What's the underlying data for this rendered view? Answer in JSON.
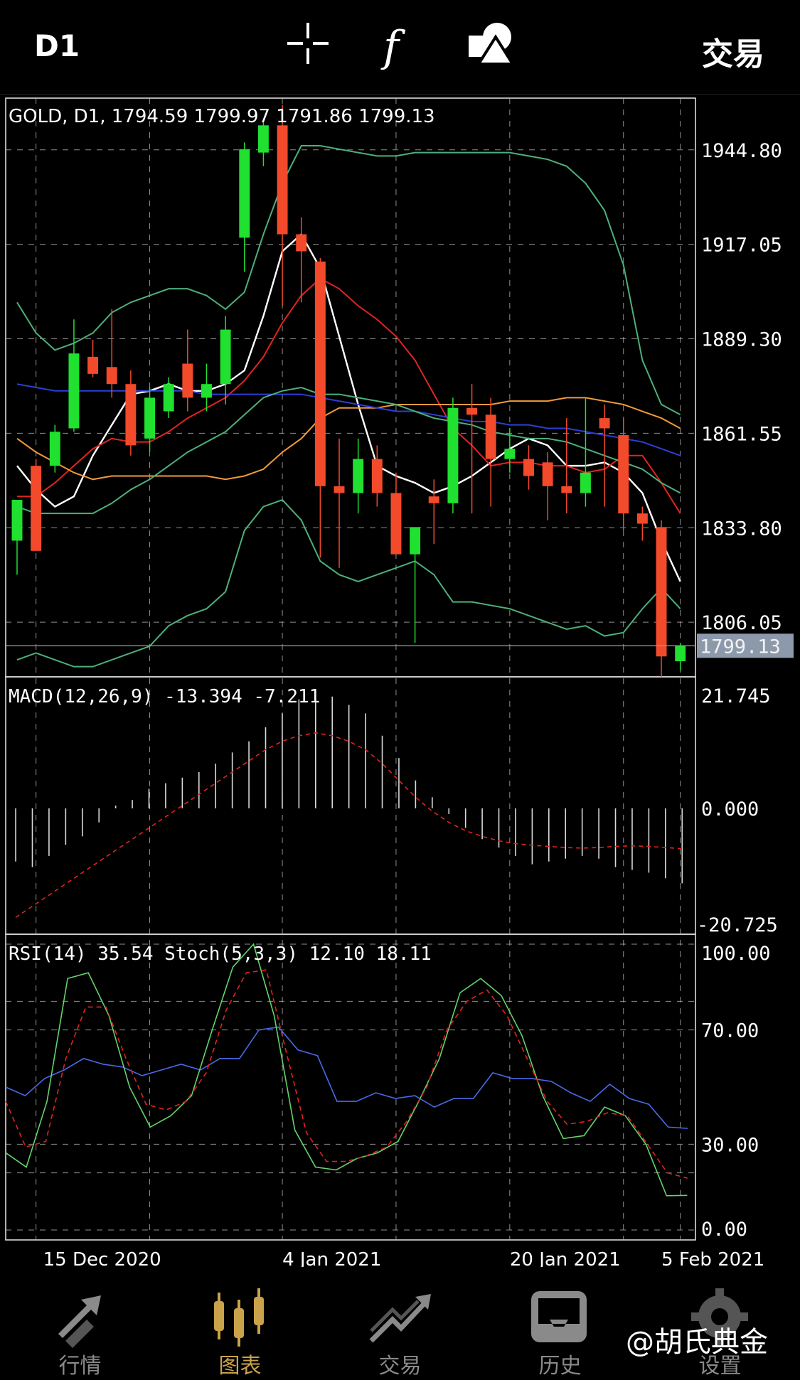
{
  "header": {
    "timeframe": "D1",
    "trade_label": "交易"
  },
  "chart_data": [
    {
      "type": "candlestick",
      "title": "GOLD, D1, 1794.59 1799.97 1791.86 1799.13",
      "x_labels": [
        "15 Dec 2020",
        "4 Jan 2021",
        "20 Jan 2021",
        "5 Feb 2021"
      ],
      "y_ticks": [
        "1944.80",
        "1917.05",
        "1889.30",
        "1861.55",
        "1833.80",
        "1806.05"
      ],
      "ylim": [
        1790,
        1960
      ],
      "last_price": "1799.13",
      "candles": [
        {
          "o": 1830,
          "h": 1836,
          "l": 1820,
          "c": 1842
        },
        {
          "o": 1852,
          "h": 1854,
          "l": 1830,
          "c": 1827
        },
        {
          "o": 1852,
          "h": 1864,
          "l": 1850,
          "c": 1862
        },
        {
          "o": 1863,
          "h": 1895,
          "l": 1862,
          "c": 1885
        },
        {
          "o": 1884,
          "h": 1889,
          "l": 1878,
          "c": 1879
        },
        {
          "o": 1881,
          "h": 1898,
          "l": 1872,
          "c": 1876
        },
        {
          "o": 1876,
          "h": 1880,
          "l": 1855,
          "c": 1858
        },
        {
          "o": 1860,
          "h": 1875,
          "l": 1856,
          "c": 1872
        },
        {
          "o": 1868,
          "h": 1878,
          "l": 1866,
          "c": 1876
        },
        {
          "o": 1882,
          "h": 1892,
          "l": 1868,
          "c": 1872
        },
        {
          "o": 1872,
          "h": 1882,
          "l": 1868,
          "c": 1876
        },
        {
          "o": 1876,
          "h": 1896,
          "l": 1870,
          "c": 1892
        },
        {
          "o": 1919,
          "h": 1947,
          "l": 1909,
          "c": 1945
        },
        {
          "o": 1944,
          "h": 1953,
          "l": 1940,
          "c": 1952
        },
        {
          "o": 1952,
          "h": 1958,
          "l": 1899,
          "c": 1920
        },
        {
          "o": 1920,
          "h": 1925,
          "l": 1900,
          "c": 1915
        },
        {
          "o": 1912,
          "h": 1913,
          "l": 1825,
          "c": 1846
        },
        {
          "o": 1846,
          "h": 1860,
          "l": 1822,
          "c": 1844
        },
        {
          "o": 1844,
          "h": 1860,
          "l": 1838,
          "c": 1854
        },
        {
          "o": 1854,
          "h": 1858,
          "l": 1840,
          "c": 1844
        },
        {
          "o": 1844,
          "h": 1850,
          "l": 1826,
          "c": 1826
        },
        {
          "o": 1826,
          "h": 1832,
          "l": 1800,
          "c": 1834
        },
        {
          "o": 1843,
          "h": 1848,
          "l": 1829,
          "c": 1841
        },
        {
          "o": 1841,
          "h": 1872,
          "l": 1838,
          "c": 1869
        },
        {
          "o": 1869,
          "h": 1876,
          "l": 1838,
          "c": 1867
        },
        {
          "o": 1867,
          "h": 1872,
          "l": 1840,
          "c": 1854
        },
        {
          "o": 1854,
          "h": 1863,
          "l": 1850,
          "c": 1857
        },
        {
          "o": 1854,
          "h": 1858,
          "l": 1845,
          "c": 1849
        },
        {
          "o": 1853,
          "h": 1856,
          "l": 1836,
          "c": 1846
        },
        {
          "o": 1846,
          "h": 1866,
          "l": 1838,
          "c": 1844
        },
        {
          "o": 1844,
          "h": 1872,
          "l": 1840,
          "c": 1850
        },
        {
          "o": 1866,
          "h": 1870,
          "l": 1840,
          "c": 1863
        },
        {
          "o": 1861,
          "h": 1866,
          "l": 1833,
          "c": 1838
        },
        {
          "o": 1838,
          "h": 1840,
          "l": 1830,
          "c": 1835
        },
        {
          "o": 1834,
          "h": 1836,
          "l": 1790,
          "c": 1796
        },
        {
          "o": 1794.59,
          "h": 1799.97,
          "l": 1791.86,
          "c": 1799.13
        }
      ],
      "overlays": [
        {
          "name": "ma-fast",
          "color": "#ffffff",
          "values": [
            1852,
            1845,
            1840,
            1843,
            1855,
            1864,
            1873,
            1874,
            1876,
            1874,
            1874,
            1876,
            1880,
            1896,
            1915,
            1920,
            1910,
            1890,
            1870,
            1852,
            1849,
            1847,
            1844,
            1846,
            1849,
            1853,
            1857,
            1860,
            1858,
            1852,
            1852,
            1853,
            1850,
            1844,
            1830,
            1818
          ]
        },
        {
          "name": "ma-mid",
          "color": "#e0241f",
          "values": [
            1843,
            1843,
            1847,
            1852,
            1857,
            1860,
            1859,
            1859,
            1862,
            1866,
            1869,
            1872,
            1877,
            1884,
            1894,
            1902,
            1907,
            1904,
            1899,
            1895,
            1890,
            1883,
            1873,
            1863,
            1858,
            1852,
            1853,
            1853,
            1852,
            1852,
            1850,
            1851,
            1855,
            1855,
            1847,
            1838
          ]
        },
        {
          "name": "ma-slow",
          "color": "#f29a3a",
          "values": [
            1860,
            1856,
            1853,
            1850,
            1848,
            1849,
            1849,
            1849,
            1849,
            1849,
            1849,
            1848,
            1849,
            1851,
            1856,
            1860,
            1866,
            1869,
            1869,
            1869,
            1870,
            1870,
            1870,
            1870,
            1870,
            1870,
            1871,
            1871,
            1871,
            1872,
            1872,
            1871,
            1870,
            1868,
            1866,
            1863
          ]
        },
        {
          "name": "ma-long",
          "color": "#2b3fd6",
          "values": [
            1876,
            1875,
            1874,
            1874,
            1874,
            1874,
            1874,
            1874,
            1874,
            1874,
            1873,
            1873,
            1873,
            1873,
            1873,
            1873,
            1872,
            1871,
            1870,
            1869,
            1868,
            1868,
            1867,
            1866,
            1865,
            1865,
            1864,
            1864,
            1863,
            1863,
            1862,
            1861,
            1860,
            1859,
            1857,
            1855
          ]
        },
        {
          "name": "bb-upper",
          "color": "#4db07a",
          "values": [
            1900,
            1891,
            1886,
            1888,
            1891,
            1897,
            1900,
            1902,
            1904,
            1904,
            1902,
            1898,
            1903,
            1920,
            1935,
            1946,
            1946,
            1945,
            1944,
            1943,
            1943,
            1944,
            1944,
            1944,
            1944,
            1944,
            1944,
            1943,
            1942,
            1940,
            1935,
            1927,
            1911,
            1883,
            1870,
            1867
          ]
        },
        {
          "name": "bb-mid",
          "color": "#4db07a",
          "values": [
            1840,
            1838,
            1838,
            1838,
            1838,
            1841,
            1845,
            1848,
            1852,
            1856,
            1859,
            1862,
            1867,
            1872,
            1874,
            1875,
            1873,
            1873,
            1872,
            1871,
            1870,
            1868,
            1866,
            1865,
            1864,
            1862,
            1861,
            1860,
            1860,
            1859,
            1857,
            1855,
            1853,
            1851,
            1847,
            1844
          ]
        },
        {
          "name": "bb-lower",
          "color": "#4db07a",
          "values": [
            1795,
            1797,
            1795,
            1793,
            1793,
            1795,
            1797,
            1799,
            1805,
            1808,
            1810,
            1815,
            1833,
            1840,
            1842,
            1836,
            1824,
            1820,
            1818,
            1820,
            1822,
            1824,
            1820,
            1812,
            1812,
            1811,
            1810,
            1808,
            1806,
            1804,
            1805,
            1802,
            1803,
            1810,
            1816,
            1810
          ]
        }
      ]
    },
    {
      "type": "bar",
      "title": "MACD(12,26,9) -13.394 -7.211",
      "y_ticks": [
        "21.745",
        "0.000",
        "-20.725"
      ],
      "ylim": [
        -20.725,
        21.745
      ],
      "histogram": [
        -9.5,
        -10.5,
        -8.5,
        -6.5,
        -5.0,
        -2.5,
        0.5,
        1.5,
        3.5,
        4.5,
        5.5,
        6.5,
        8.0,
        10.0,
        12.0,
        14.5,
        17.0,
        19.5,
        21.0,
        20.0,
        18.5,
        17.0,
        13.0,
        9.0,
        5.0,
        2.0,
        -1.0,
        -3.5,
        -5.5,
        -7.0,
        -8.5,
        -10.0,
        -9.5,
        -9.0,
        -8.5,
        -9.0,
        -10.5,
        -11.0,
        -11.5,
        -12.5,
        -13.394
      ],
      "signal": [
        -19.5,
        -17.5,
        -15.5,
        -13.5,
        -11.5,
        -9.5,
        -7.5,
        -5.5,
        -3.5,
        -1.5,
        0.5,
        2.5,
        4.5,
        6.5,
        8.5,
        10.5,
        12.0,
        13.0,
        13.5,
        13.0,
        12.0,
        10.5,
        8.0,
        5.0,
        2.0,
        -0.5,
        -2.5,
        -4.0,
        -5.0,
        -5.8,
        -6.3,
        -6.6,
        -6.8,
        -7.0,
        -7.1,
        -7.0,
        -6.8,
        -6.7,
        -6.8,
        -7.0,
        -7.211
      ]
    },
    {
      "type": "line",
      "title": "RSI(14) 35.54 Stoch(5,3,3) 12.10 18.11",
      "y_ticks": [
        "100.00",
        "70.00",
        "30.00",
        "0.00"
      ],
      "ylim": [
        0,
        100
      ],
      "series": [
        {
          "name": "RSI(14)",
          "color": "#4a6ae8",
          "values": [
            50,
            47,
            53,
            56,
            60,
            58,
            57,
            54,
            56,
            58,
            56,
            60,
            60,
            70,
            71,
            63,
            61,
            45,
            45,
            48,
            46,
            47,
            43,
            46,
            46,
            55,
            53,
            53,
            52,
            48,
            45,
            51,
            46,
            44,
            36,
            35.54
          ]
        },
        {
          "name": "Stoch(5,3,3)",
          "color": "#63d36b",
          "values": [
            27,
            22,
            45,
            88,
            90,
            75,
            50,
            36,
            40,
            47,
            70,
            92,
            100,
            75,
            35,
            22,
            21,
            25,
            27,
            31,
            45,
            60,
            83,
            88,
            82,
            68,
            47,
            32,
            33,
            43,
            40,
            30,
            12,
            12.1
          ]
        },
        {
          "name": "Stoch signal",
          "color": "#e0241f",
          "values": [
            45,
            29,
            31,
            60,
            78,
            78,
            60,
            44,
            42,
            45,
            55,
            77,
            90,
            91,
            62,
            34,
            24,
            24,
            26,
            29,
            38,
            50,
            70,
            80,
            84,
            75,
            60,
            45,
            37,
            38,
            41,
            40,
            30,
            20,
            18.11
          ]
        }
      ]
    }
  ],
  "tabs": [
    {
      "label": "行情",
      "icon": "quotes-arrows-icon"
    },
    {
      "label": "图表",
      "icon": "chart-candles-icon"
    },
    {
      "label": "交易",
      "icon": "trade-trend-icon"
    },
    {
      "label": "历史",
      "icon": "history-inbox-icon"
    },
    {
      "label": "设置",
      "icon": "settings-gear-icon"
    }
  ],
  "watermark": "@胡氏典金",
  "colors": {
    "bull": "#20e030",
    "bear": "#f24a2b",
    "accent": "#c9a24a",
    "grid": "#bfbfbf"
  }
}
